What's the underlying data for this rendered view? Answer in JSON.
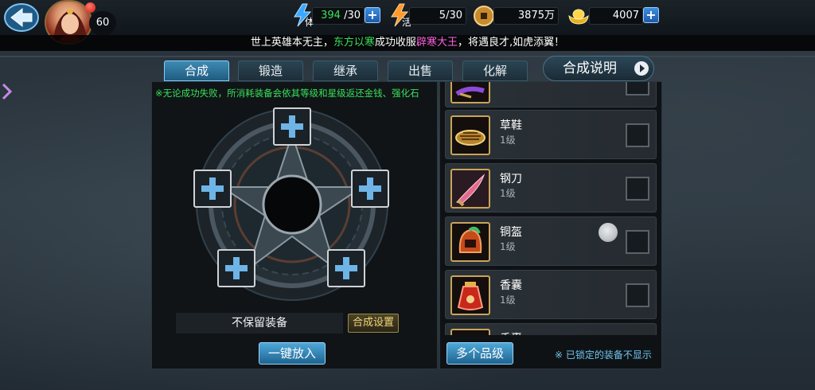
{
  "header": {
    "player_level": "60",
    "stamina": {
      "value": "394",
      "max": "/30",
      "label": "体"
    },
    "energy": {
      "value": "5/30",
      "label": "活"
    },
    "copper": {
      "value": "3875万"
    },
    "gold": {
      "value": "4007"
    }
  },
  "marquee": {
    "part1": "世上英雄本无主，",
    "name1": "东方以寒",
    "part2": "成功收服",
    "name2": "辟寒大王",
    "part3": "，将遇良才,如虎添翼！"
  },
  "tabs": [
    {
      "label": "合成",
      "active": true
    },
    {
      "label": "锻造",
      "active": false
    },
    {
      "label": "继承",
      "active": false
    },
    {
      "label": "出售",
      "active": false
    },
    {
      "label": "化解",
      "active": false
    }
  ],
  "help_label": "合成说明",
  "synth": {
    "notice": "※无论成功失败，所消耗装备会依其等级和星级返还金钱、强化石",
    "keep_label": "不保留装备",
    "settings_label": "合成设置",
    "put_all_label": "一键放入"
  },
  "items": [
    {
      "name": "",
      "level": "",
      "icon": "weapon-icon"
    },
    {
      "name": "草鞋",
      "level": "1级",
      "icon": "straw-sandal-icon"
    },
    {
      "name": "钢刀",
      "level": "1级",
      "icon": "steel-blade-icon"
    },
    {
      "name": "铜盔",
      "level": "1级",
      "icon": "bronze-helmet-icon"
    },
    {
      "name": "香囊",
      "level": "1级",
      "icon": "sachet-icon"
    },
    {
      "name": "香囊",
      "level": "",
      "icon": "sachet-icon"
    }
  ],
  "multi_grade_label": "多个品级",
  "locked_note": "※ 已锁定的装备不显示"
}
